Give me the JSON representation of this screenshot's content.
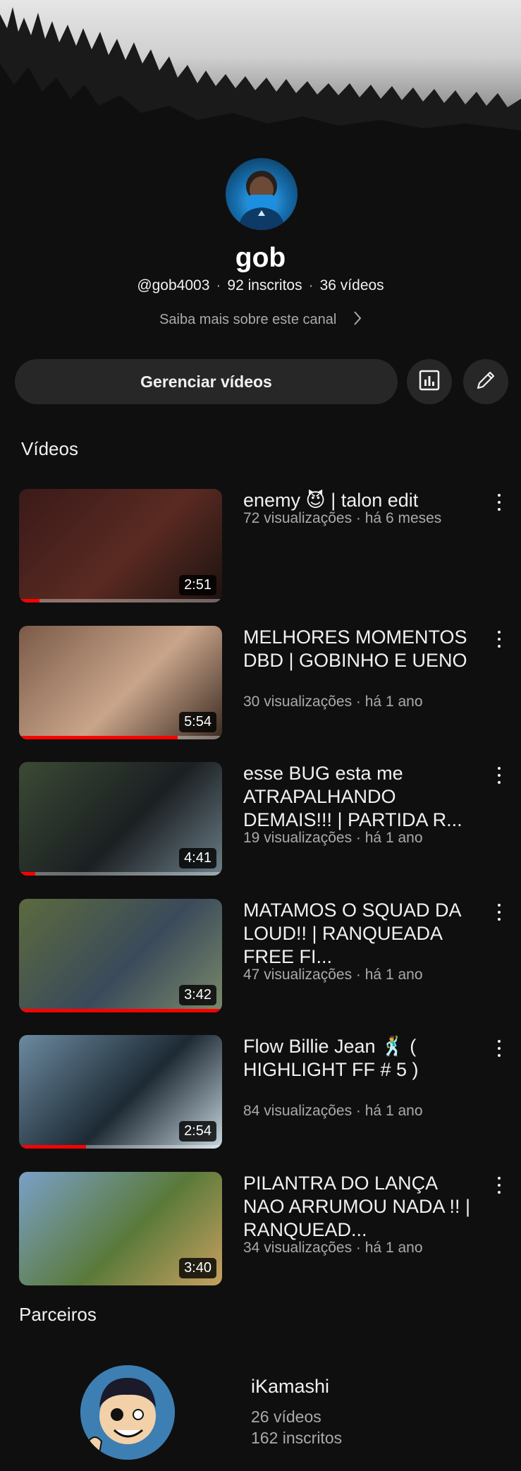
{
  "channel": {
    "name": "gob",
    "handle": "@gob4003",
    "subscribers": "92 inscritos",
    "video_count": "36 vídeos",
    "about_link": "Saiba mais sobre este canal"
  },
  "actions": {
    "manage_label": "Gerenciar vídeos",
    "analytics_icon": "analytics-icon",
    "edit_icon": "pencil-icon"
  },
  "sections": {
    "videos": "Vídeos",
    "partners": "Parceiros"
  },
  "videos": [
    {
      "title": "enemy 😈 | talon edit",
      "meta": "72 visualizações · há 6 meses",
      "duration": "2:51",
      "watched": 0.1
    },
    {
      "title": "MELHORES MOMENTOS DBD | GOBINHO E UENO",
      "meta": "30 visualizações · há 1 ano",
      "duration": "5:54",
      "watched": 0.78
    },
    {
      "title": "esse BUG esta me ATRAPALHANDO DEMAIS!!! | PARTIDA R...",
      "meta": "19 visualizações · há 1 ano",
      "duration": "4:41",
      "watched": 0.08
    },
    {
      "title": "MATAMOS O SQUAD DA LOUD!! | RANQUEADA FREE FI...",
      "meta": "47 visualizações · há 1 ano",
      "duration": "3:42",
      "watched": 1.0
    },
    {
      "title": "Flow Billie Jean 🕺 ( HIGHLIGHT FF # 5 )",
      "meta": "84 visualizações · há 1 ano",
      "duration": "2:54",
      "watched": 0.33
    },
    {
      "title": "PILANTRA DO LANÇA NAO ARRUMOU NADA !! | RANQUEAD...",
      "meta": "34 visualizações · há 1 ano",
      "duration": "3:40",
      "watched": 0
    }
  ],
  "partner": {
    "name": "iKamashi",
    "videos": "26 vídeos",
    "subscribers": "162 inscritos"
  },
  "colors": {
    "background": "#0f0f0f",
    "surface": "#272727",
    "progress": "#ff0000",
    "secondary_text": "#aaaaaa"
  }
}
